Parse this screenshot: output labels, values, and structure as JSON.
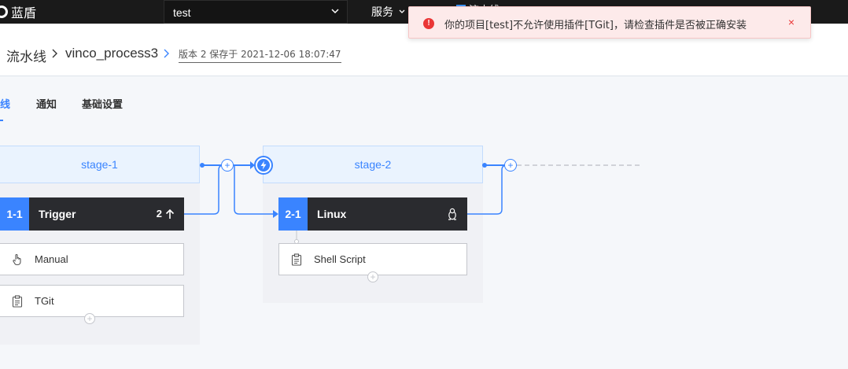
{
  "app": {
    "logo_text": "蓝盾"
  },
  "topbar": {
    "project_value": "test",
    "services_label": "服务",
    "pipeline_label": "流水线"
  },
  "breadcrumb": {
    "root": "流水线",
    "pipeline_name": "vinco_process3",
    "version_text": "版本 2 保存于 2021-12-06 18:07:47"
  },
  "toast": {
    "message": "你的项目[test]不允许使用插件[TGit]，请检查插件是否被正确安装",
    "close": "×"
  },
  "tabs": [
    {
      "label": "线",
      "active": true
    },
    {
      "label": "通知",
      "active": false
    },
    {
      "label": "基础设置",
      "active": false
    }
  ],
  "stages": [
    {
      "name": "stage-1",
      "job": {
        "num": "1-1",
        "name": "Trigger",
        "extra": "2"
      },
      "tasks": [
        {
          "name": "Manual",
          "icon": "hand-pointer-icon"
        },
        {
          "name": "TGit",
          "icon": "clipboard-icon"
        }
      ]
    },
    {
      "name": "stage-2",
      "job": {
        "num": "2-1",
        "name": "Linux",
        "os_icon": "linux-penguin-icon"
      },
      "tasks": [
        {
          "name": "Shell Script",
          "icon": "clipboard-icon"
        }
      ]
    }
  ],
  "colors": {
    "accent": "#3a84ff",
    "error": "#ea3636",
    "topbar": "#1a1a1a",
    "job_head": "#2a2b2f"
  }
}
